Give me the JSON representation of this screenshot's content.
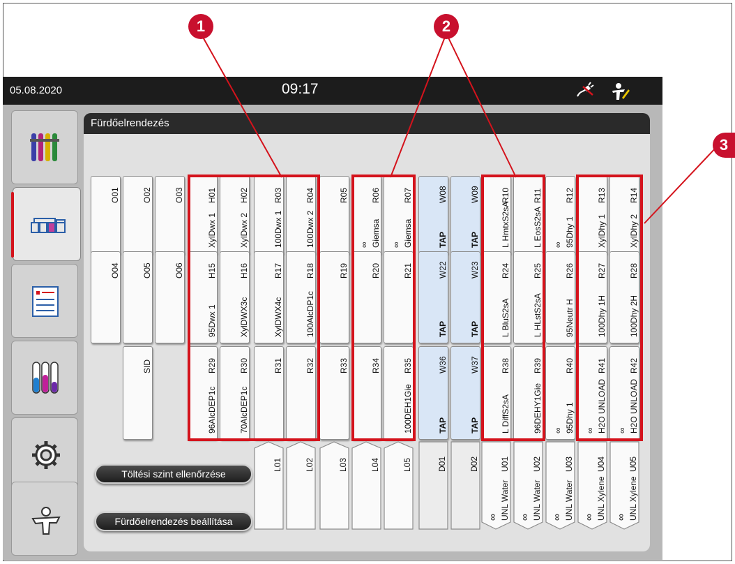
{
  "statusbar": {
    "date": "05.08.2020",
    "time": "09:17"
  },
  "panel": {
    "title": "Fürdőelrendezés"
  },
  "nav": [
    {
      "name": "reagents-nav",
      "icon": "reagents-icon"
    },
    {
      "name": "bath-layout-nav",
      "icon": "bath-layout-icon",
      "active": true
    },
    {
      "name": "programs-nav",
      "icon": "program-list-icon"
    },
    {
      "name": "tubes-nav",
      "icon": "reagent-tubes-icon"
    },
    {
      "name": "settings-nav",
      "icon": "gear-icon"
    },
    {
      "name": "user-nav",
      "icon": "user-icon"
    }
  ],
  "buttons": {
    "fill_level": "Töltési szint ellenőrzése",
    "layout_setup": "Fürdőelrendezés beállítása"
  },
  "callouts": [
    "1",
    "2",
    "2",
    "3"
  ],
  "row1": [
    {
      "code": "O01"
    },
    {
      "code": "O02"
    },
    {
      "code": "O03"
    },
    {
      "code": "H01",
      "name": "XylDwx 1"
    },
    {
      "code": "H02",
      "name": "XylDwx 2"
    },
    {
      "code": "R03",
      "name": "100Dwx 1"
    },
    {
      "code": "R04",
      "name": "100Dwx 2"
    },
    {
      "code": "R05"
    },
    {
      "code": "R06",
      "name": "Giemsa",
      "sub": "∞"
    },
    {
      "code": "R07",
      "name": "Giemsa",
      "sub": "∞"
    },
    {
      "code": "W08",
      "name": "TAP",
      "water": true
    },
    {
      "code": "W09",
      "name": "TAP",
      "water": true
    },
    {
      "code": "R10",
      "name": "L HmtxS2sA"
    },
    {
      "code": "R11",
      "name": "L EosS2sA"
    },
    {
      "code": "R12",
      "name": "95Dhy 1",
      "sub": "∞"
    },
    {
      "code": "R13",
      "name": "XylDhy 1"
    },
    {
      "code": "R14",
      "name": "XylDhy 2"
    }
  ],
  "row2": [
    {
      "code": "O04"
    },
    {
      "code": "O05"
    },
    {
      "code": "O06"
    },
    {
      "code": "H15",
      "name": "95Dwx 1"
    },
    {
      "code": "H16",
      "name": "XylDWX3c"
    },
    {
      "code": "R17",
      "name": "XylDWX4c"
    },
    {
      "code": "R18",
      "name": "100AlcDP1c"
    },
    {
      "code": "R19"
    },
    {
      "code": "R20"
    },
    {
      "code": "R21"
    },
    {
      "code": "W22",
      "name": "TAP",
      "water": true
    },
    {
      "code": "W23",
      "name": "TAP",
      "water": true
    },
    {
      "code": "R24",
      "name": "L BluS2sA"
    },
    {
      "code": "R25",
      "name": "L HLstS2sA"
    },
    {
      "code": "R26",
      "name": "95Neutr H"
    },
    {
      "code": "R27",
      "name": "100Dhy 1H"
    },
    {
      "code": "R28",
      "name": "100Dhy 2H"
    }
  ],
  "row3": [
    {
      "code": "SID"
    },
    {
      "code": "R29",
      "name": "96AlcDEP1c"
    },
    {
      "code": "R30",
      "name": "70AlcDEP1c"
    },
    {
      "code": "R31"
    },
    {
      "code": "R32"
    },
    {
      "code": "R33"
    },
    {
      "code": "R34"
    },
    {
      "code": "R35",
      "name": "100DEH1Gie"
    },
    {
      "code": "W36",
      "name": "TAP",
      "water": true
    },
    {
      "code": "W37",
      "name": "TAP",
      "water": true
    },
    {
      "code": "R38",
      "name": "L DiffS2sA"
    },
    {
      "code": "R39",
      "name": "96DEHY1Gie"
    },
    {
      "code": "R40",
      "name": "95Dhy 1",
      "sub": "∞"
    },
    {
      "code": "R41",
      "name": "H2O UNLOAD",
      "sub": "∞"
    },
    {
      "code": "R42",
      "name": "H2O UNLOAD",
      "sub": "∞"
    }
  ],
  "row4": [
    {
      "code": "L01",
      "kind": "load"
    },
    {
      "code": "L02",
      "kind": "load"
    },
    {
      "code": "L03",
      "kind": "load"
    },
    {
      "code": "L04",
      "kind": "load"
    },
    {
      "code": "L05",
      "kind": "load"
    },
    {
      "code": "D01",
      "kind": "drain"
    },
    {
      "code": "D02",
      "kind": "drain"
    },
    {
      "code": "U01",
      "name": "UNL Water",
      "sub": "∞",
      "kind": "unload"
    },
    {
      "code": "U02",
      "name": "UNL Water",
      "sub": "∞",
      "kind": "unload"
    },
    {
      "code": "U03",
      "name": "UNL Water",
      "sub": "∞",
      "kind": "unload"
    },
    {
      "code": "U04",
      "name": "UNL Xylene",
      "sub": "∞",
      "kind": "unload"
    },
    {
      "code": "U05",
      "name": "UNL Xylene",
      "sub": "∞",
      "kind": "unload"
    }
  ]
}
